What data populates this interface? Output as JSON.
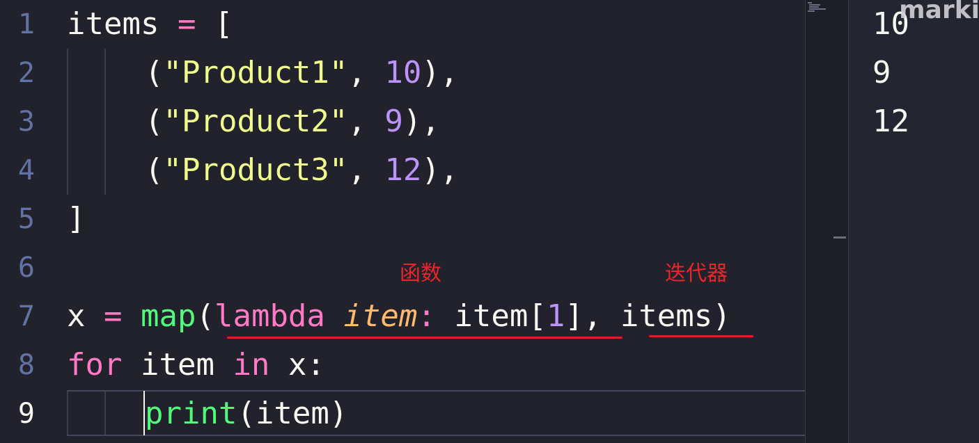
{
  "editor": {
    "line_numbers": [
      "1",
      "2",
      "3",
      "4",
      "5",
      "6",
      "7",
      "8",
      "9"
    ],
    "line1": {
      "name": "items",
      "op": " = ",
      "open": "["
    },
    "line2": {
      "open": "(",
      "str": "\"Product1\"",
      "comma": ", ",
      "num": "10",
      "close": "),"
    },
    "line3": {
      "open": "(",
      "str": "\"Product2\"",
      "comma": ", ",
      "num": "9",
      "close": "),"
    },
    "line4": {
      "open": "(",
      "str": "\"Product3\"",
      "comma": ", ",
      "num": "12",
      "close": "),"
    },
    "line5": {
      "close": "]"
    },
    "line7": {
      "var": "x",
      "op": " = ",
      "func": "map",
      "paren_open": "(",
      "keyword": "lambda",
      "space": " ",
      "param": "item",
      "colon": ": ",
      "body_a": "item[",
      "index": "1",
      "body_b": "], ",
      "iterable": "items",
      "paren_close": ")"
    },
    "line8": {
      "kw_for": "for",
      "var": " item ",
      "kw_in": "in",
      "rest": " x:"
    },
    "line9": {
      "func": "print",
      "args": "(item)"
    }
  },
  "annotations": {
    "function_label": "函数",
    "iterator_label": "迭代器"
  },
  "output": {
    "lines": [
      "10",
      "9",
      "12"
    ],
    "watermark": "marki"
  },
  "colors": {
    "background": "#21222c",
    "keyword": "#ff79c6",
    "string": "#f1fa8c",
    "number": "#bd93f9",
    "function": "#50fa7b",
    "parameter": "#ffb86c",
    "annotation": "#e8262a"
  }
}
